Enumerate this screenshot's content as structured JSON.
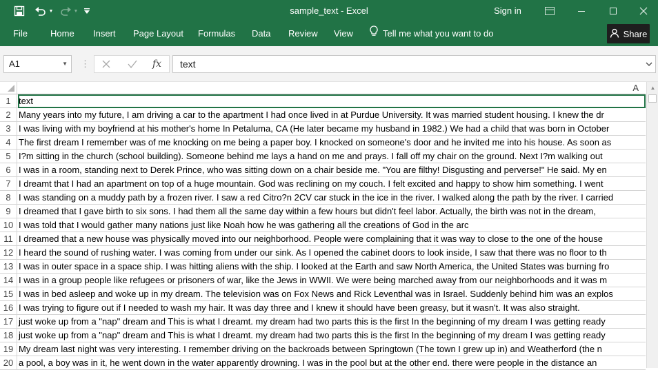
{
  "window": {
    "title": "sample_text  -  Excel",
    "sign_in": "Sign in"
  },
  "ribbon": {
    "tabs": [
      "File",
      "Home",
      "Insert",
      "Page Layout",
      "Formulas",
      "Data",
      "Review",
      "View"
    ],
    "tell_me": "Tell me what you want to do",
    "share": "Share"
  },
  "formula_bar": {
    "name_box": "A1",
    "fx_label": "fx",
    "content": "text"
  },
  "sheet": {
    "column_header": "A",
    "rows": [
      {
        "num": "1",
        "text": "text"
      },
      {
        "num": "2",
        "text": "Many years into my future, I am driving a car to the apartment I had once lived in at Purdue University. It was married student housing. I knew the dr"
      },
      {
        "num": "3",
        "text": "I was living with my boyfriend at his mother's home In Petaluma, CA (He later became my husband in 1982.) We had a child that was born in October"
      },
      {
        "num": "4",
        "text": "The first dream I remember was of me knocking on me being a paper boy. I knocked on someone's door and he invited me into his house. As soon as"
      },
      {
        "num": "5",
        "text": "I?m sitting in the church (school building). Someone behind me lays a hand on me and prays. I fall off my chair on the ground. Next I?m walking out"
      },
      {
        "num": "6",
        "text": "I was in a room, standing next to Derek Prince, who was sitting down on a chair beside me. \"You are filthy! Disgusting and perverse!\" He said. My  en"
      },
      {
        "num": "7",
        "text": "I dreamt that I had an apartment on top of a huge mountain. God was reclining on my couch. I felt excited and happy to show him something. I went"
      },
      {
        "num": "8",
        "text": "I was standing on a muddy path by a frozen river. I saw a red Citro?n 2CV car stuck in the ice in the river. I walked along the path by the river. I carried"
      },
      {
        "num": "9",
        "text": "I dreamed that I gave birth to six sons.  I had them all the same day within a few hours but didn't feel labor.  Actually, the birth was not in the dream,"
      },
      {
        "num": "10",
        "text": "I was told that I would gather many nations just like Noah how he was gathering all the creations of God in the arc"
      },
      {
        "num": "11",
        "text": "I dreamed that a new house was physically moved into our neighborhood.  People were complaining that it was way to close to the one of the house"
      },
      {
        "num": "12",
        "text": "I heard the sound of rushing water. I was coming from under our sink. As I opened the cabinet doors to look inside, I saw that there was no floor to th"
      },
      {
        "num": "13",
        "text": "I was in outer space in a space ship. I was hitting aliens with the ship. I looked at the Earth and saw North America, the United States was burning fro"
      },
      {
        "num": "14",
        "text": "I was in a group people like refugees or prisoners of war, like the Jews in WWII. We were being marched away from our neighborhoods and it was m"
      },
      {
        "num": "15",
        "text": "I was in bed asleep and woke up in my dream. The television was on Fox News and Rick Leventhal was in Israel.  Suddenly behind him was an explos"
      },
      {
        "num": "16",
        "text": "I was trying to figure out if I needed to wash my hair. It was day three and I knew it should have been greasy, but it wasn't. It was also straight."
      },
      {
        "num": "17",
        "text": "just woke up from a \"nap\" dream and This is what I dreamt. my dream had two parts this is the first  In the beginning of my dream I was getting ready"
      },
      {
        "num": "18",
        "text": "just woke up from a \"nap\" dream and This is what I dreamt. my dream had two parts this is the first  In the beginning of my dream I was getting ready"
      },
      {
        "num": "19",
        "text": "My dream last night was very interesting.  I remember driving on the backroads between Springtown (The town I grew up in) and Weatherford (the n"
      },
      {
        "num": "20",
        "text": "a pool, a boy was in it, he went down in the water apparently  drowning. I was in the pool but at the other end. there were people in the distance an"
      }
    ]
  },
  "icons": {
    "save": "save-icon",
    "undo": "undo-icon",
    "redo": "redo-icon",
    "customize": "customize-qat-icon",
    "ribbon_options": "ribbon-display-options-icon",
    "minimize": "minimize-icon",
    "maximize": "maximize-icon",
    "close": "close-icon",
    "lightbulb": "lightbulb-icon",
    "person": "person-icon"
  },
  "colors": {
    "excel_green": "#217346",
    "share_bg": "#1e1e1e",
    "gridline": "#d4d4d4"
  }
}
